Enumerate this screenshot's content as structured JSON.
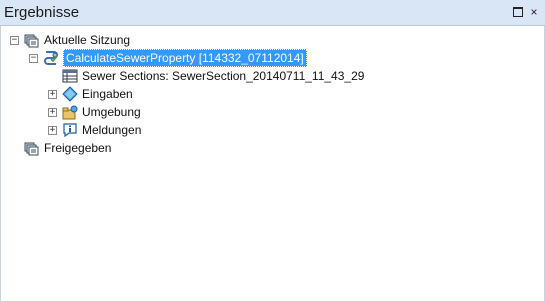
{
  "window": {
    "title": "Ergebnisse",
    "maximize_label": "",
    "close_label": "×"
  },
  "tree": {
    "current_session": {
      "label": "Aktuelle Sitzung",
      "expander": "−",
      "job": {
        "label": "CalculateSewerProperty [114332_07112014]",
        "expander": "−",
        "output": {
          "label": "Sewer Sections: SewerSection_20140711_11_43_29"
        },
        "inputs": {
          "label": "Eingaben",
          "expander": "+"
        },
        "environment": {
          "label": "Umgebung",
          "expander": "+"
        },
        "messages": {
          "label": "Meldungen",
          "expander": "+"
        }
      }
    },
    "shared": {
      "label": "Freigegeben"
    }
  },
  "colors": {
    "selection": "#3399ff",
    "titlebar": "#d9e6f6"
  }
}
